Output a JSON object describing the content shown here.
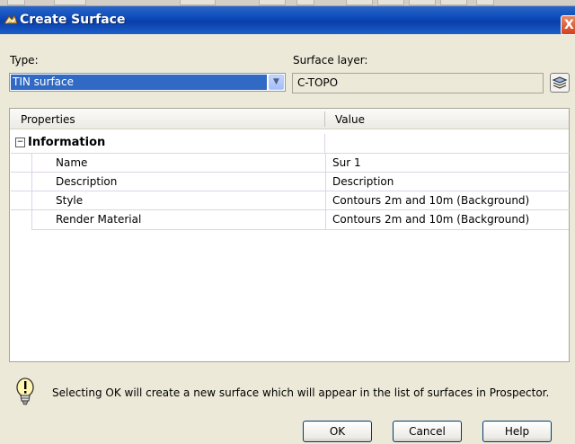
{
  "window": {
    "title": "Create Surface",
    "close_glyph": "X"
  },
  "type_field": {
    "label": "Type:",
    "value": "TIN surface"
  },
  "surface_layer": {
    "label": "Surface layer:",
    "value": "C-TOPO"
  },
  "grid": {
    "headers": [
      "Properties",
      "Value"
    ],
    "group": {
      "label": "Information",
      "expander": "−"
    },
    "rows": [
      {
        "property": "Name",
        "value": "Sur 1"
      },
      {
        "property": "Description",
        "value": "Description"
      },
      {
        "property": "Style",
        "value": "Contours 2m and 10m (Background)"
      },
      {
        "property": "Render Material",
        "value": "Contours 2m and 10m (Background)"
      }
    ]
  },
  "info_message": "Selecting OK will create a new surface which will appear in the list of surfaces in Prospector.",
  "buttons": {
    "ok": "OK",
    "cancel": "Cancel",
    "help": "Help"
  },
  "colors": {
    "titlebar": "#0a48b8",
    "selection": "#316ac5",
    "dialog_bg": "#ece9d8"
  }
}
